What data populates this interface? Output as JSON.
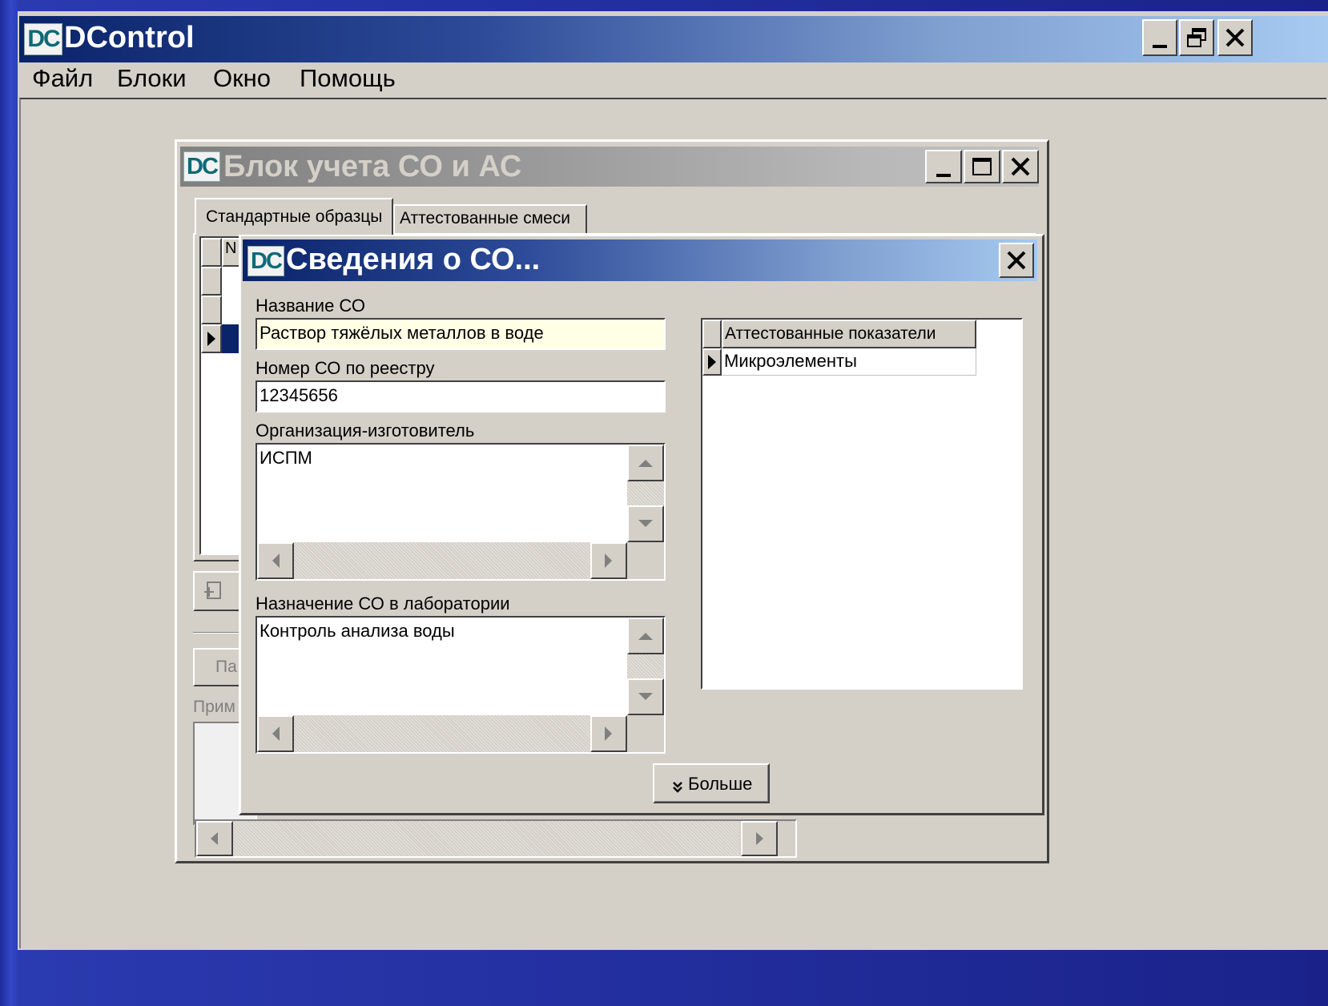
{
  "app": {
    "logo": "DC",
    "title": "DControl",
    "menu": [
      "Файл",
      "Блоки",
      "Окно",
      "Помощь"
    ]
  },
  "block_window": {
    "logo": "DC",
    "title": "Блок учета СО и АС",
    "tabs": [
      "Стандартные образцы",
      "Аттестованные смеси"
    ],
    "grid_header_partial": "N",
    "partial_button_label": "Па",
    "partial_label": "Прим"
  },
  "dialog": {
    "logo": "DC",
    "title": "Сведения о СО...",
    "name_label": "Название СО",
    "name_value": "Раствор тяжёлых металлов в воде",
    "registry_label": "Номер СО по реестру",
    "registry_value": "12345656",
    "manufacturer_label": "Организация-изготовитель",
    "manufacturer_value": "ИСПМ",
    "purpose_label": "Назначение СО в лаборатории",
    "purpose_value": "Контроль анализа воды",
    "indicators_header": "Аттестованные показатели",
    "indicators": [
      "Микроэлементы"
    ],
    "more_button": "Больше"
  },
  "colors": {
    "desktop": "#1f2a9a",
    "window_face": "#d4d0c8",
    "active_title_start": "#0a246a",
    "active_title_end": "#a6caf0",
    "inactive_title_start": "#808080",
    "inactive_title_end": "#c0c0c0",
    "name_field_bg": "#ffffe6"
  }
}
